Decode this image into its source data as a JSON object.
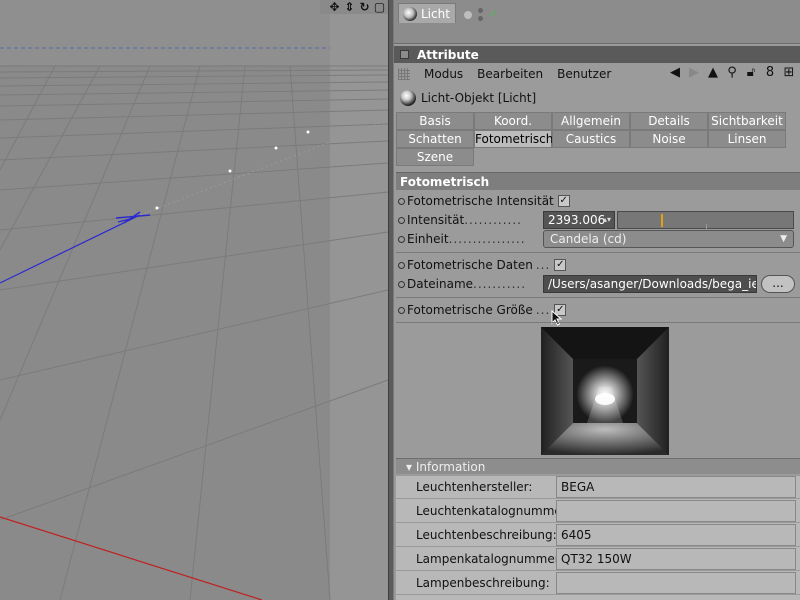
{
  "object_tab": {
    "label": "Licht"
  },
  "attribute_panel": {
    "title": "Attribute"
  },
  "menubar": {
    "items": [
      "Modus",
      "Bearbeiten",
      "Benutzer"
    ]
  },
  "object": {
    "title": "Licht-Objekt [Licht]"
  },
  "tabs": {
    "row1": [
      "Basis",
      "Koord.",
      "Allgemein",
      "Details",
      "Sichtbarkeit"
    ],
    "row2": [
      "Schatten",
      "Fotometrisch",
      "Caustics",
      "Noise",
      "Linsen"
    ],
    "row3": [
      "Szene"
    ],
    "active": "Fotometrisch"
  },
  "section": {
    "title": "Fotometrisch"
  },
  "fields": {
    "fotometrische_intensitaet": {
      "label": "Fotometrische Intensität",
      "checked": true
    },
    "intensitaet": {
      "label": "Intensität",
      "dots": "............",
      "value": "2393.006",
      "slider_fraction": 0.25
    },
    "einheit": {
      "label": "Einheit",
      "dots": "................",
      "value": "Candela (cd)"
    },
    "fotometrische_daten": {
      "label": "Fotometrische Daten",
      "dots": "...",
      "checked": true
    },
    "dateiname": {
      "label": "Dateiname",
      "dots": "...........",
      "value": "/Users/asanger/Downloads/bega_ies/",
      "button": "..."
    },
    "fotometrische_groesse": {
      "label": "Fotometrische Größe",
      "dots": "...",
      "checked": true
    }
  },
  "information": {
    "title": "Information",
    "rows": [
      {
        "label": "Leuchtenhersteller:",
        "value": "BEGA"
      },
      {
        "label": "Leuchtenkatalognummer:",
        "value": ""
      },
      {
        "label": "Leuchtenbeschreibung:",
        "value": "6405"
      },
      {
        "label": "Lampenkatalognummer:",
        "value": "QT32  150W"
      },
      {
        "label": "Lampenbeschreibung:",
        "value": ""
      }
    ]
  },
  "colors": {
    "accent_slider": "#e0a010",
    "active_tab": "#bcbcbc",
    "viewport": "#8a8a8a",
    "axis_blue": "#2a2ad0",
    "axis_red": "#c02020"
  }
}
